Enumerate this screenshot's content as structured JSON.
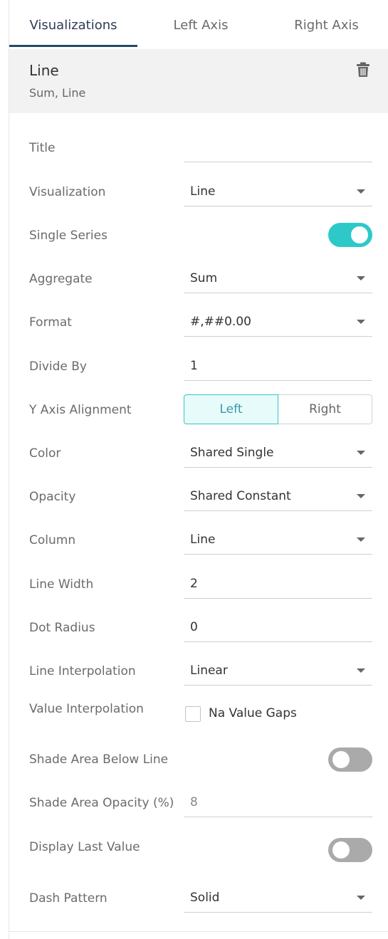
{
  "tabs": [
    {
      "label": "Visualizations",
      "active": true
    },
    {
      "label": "Left Axis",
      "active": false
    },
    {
      "label": "Right Axis",
      "active": false
    }
  ],
  "header": {
    "title": "Line",
    "subtitle": "Sum, Line",
    "delete_icon": "trash-icon"
  },
  "colors": {
    "accent": "#2dc9c9",
    "tab_underline": "#24496b",
    "toggle_off": "#aaaaaa"
  },
  "settings": {
    "title": {
      "label": "Title",
      "value": ""
    },
    "visualization": {
      "label": "Visualization",
      "value": "Line"
    },
    "single_series": {
      "label": "Single Series",
      "on": true
    },
    "aggregate": {
      "label": "Aggregate",
      "value": "Sum"
    },
    "format": {
      "label": "Format",
      "value": "#,##0.00"
    },
    "divide_by": {
      "label": "Divide By",
      "value": "1"
    },
    "y_axis_alignment": {
      "label": "Y Axis Alignment",
      "options": [
        "Left",
        "Right"
      ],
      "selected": "Left"
    },
    "color": {
      "label": "Color",
      "value": "Shared Single"
    },
    "opacity": {
      "label": "Opacity",
      "value": "Shared Constant"
    },
    "column": {
      "label": "Column",
      "value": "Line"
    },
    "line_width": {
      "label": "Line Width",
      "value": "2"
    },
    "dot_radius": {
      "label": "Dot Radius",
      "value": "0"
    },
    "line_interpolation": {
      "label": "Line Interpolation",
      "value": "Linear"
    },
    "value_interpolation": {
      "label": "Value Interpolation",
      "checkbox_label": "Na Value Gaps",
      "checked": false
    },
    "shade_area_below_line": {
      "label": "Shade Area Below Line",
      "on": false
    },
    "shade_area_opacity": {
      "label": "Shade Area Opacity (%)",
      "value": "8"
    },
    "display_last_value": {
      "label": "Display Last Value",
      "on": false
    },
    "dash_pattern": {
      "label": "Dash Pattern",
      "value": "Solid"
    }
  }
}
